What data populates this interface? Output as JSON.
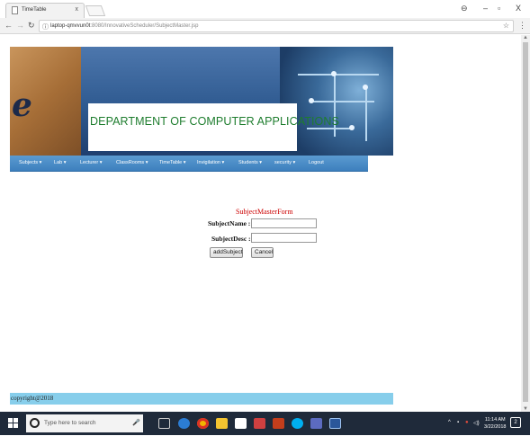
{
  "browser": {
    "tab_title": "TimeTable",
    "tab_close": "x",
    "url_host": "laptop-qmvvun0t",
    "url_rest": ":8080/InnovativeScheduler/SubjectMaster.jsp",
    "window_controls": [
      "⊖",
      "–",
      "▫",
      "X"
    ]
  },
  "banner": {
    "logo_letter": "e",
    "department": "DEPARTMENT OF COMPUTER APPLICATIONS"
  },
  "nav": {
    "items": [
      "Subjects ▾",
      "Lab ▾",
      "Lecturer ▾",
      "ClassRooms ▾",
      "TimeTable ▾",
      "Invigilation ▾",
      "Students ▾",
      "security ▾",
      "Logout"
    ]
  },
  "form": {
    "title": "SubjectMasterForm",
    "subject_name_label": "SubjectName :",
    "subject_name_value": "",
    "subject_desc_label": "SubjectDesc :",
    "subject_desc_value": "",
    "add_button": "addSubject",
    "cancel_button": "Cancel"
  },
  "footer": {
    "copyright": "copyright@2018"
  },
  "taskbar": {
    "search_placeholder": "Type here to search",
    "time": "11:14 AM",
    "date": "3/22/2018",
    "notifications": "2"
  },
  "colors": {
    "nav_bar": "#3d7fbd",
    "footer": "#87ceeb",
    "form_title": "#cc0000",
    "department_text": "#1e7d2e"
  }
}
